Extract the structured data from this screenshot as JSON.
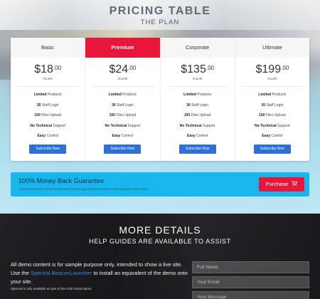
{
  "header": {
    "title": "PRICING TABLE",
    "subtitle": "THE PLAN"
  },
  "plans": [
    {
      "name": "Basic",
      "currency": "$",
      "amount": "18",
      "cents": ".00",
      "period": "/month",
      "features": [
        {
          "bold": "Limited",
          "text": " Products"
        },
        {
          "bold": "30",
          "text": " Staff Login"
        },
        {
          "bold": "150",
          "text": " Files Upload"
        },
        {
          "bold": "No Technical",
          "text": " Support"
        },
        {
          "bold": "Easy",
          "text": " Control"
        }
      ],
      "button": "Subscribe Now",
      "featured": false
    },
    {
      "name": "Premium",
      "currency": "$",
      "amount": "24",
      "cents": ".00",
      "period": "/month",
      "features": [
        {
          "bold": "Limited",
          "text": " Products"
        },
        {
          "bold": "30",
          "text": " Staff Login"
        },
        {
          "bold": "150",
          "text": " Files Upload"
        },
        {
          "bold": "No Technical",
          "text": " Support"
        },
        {
          "bold": "Easy",
          "text": " Control"
        }
      ],
      "button": "Subscribe Now",
      "featured": true
    },
    {
      "name": "Corporate",
      "currency": "$",
      "amount": "135",
      "cents": ".00",
      "period": "/month",
      "features": [
        {
          "bold": "Limited",
          "text": " Products"
        },
        {
          "bold": "30",
          "text": " Staff Login"
        },
        {
          "bold": "150",
          "text": " Files Upload"
        },
        {
          "bold": "No Technical",
          "text": " Support"
        },
        {
          "bold": "Easy",
          "text": " Control"
        }
      ],
      "button": "Subscribe Now",
      "featured": false
    },
    {
      "name": "Ultimate",
      "currency": "$",
      "amount": "199",
      "cents": ".00",
      "period": "/month",
      "features": [
        {
          "bold": "Limited",
          "text": " Products"
        },
        {
          "bold": "30",
          "text": " Staff Login"
        },
        {
          "bold": "150",
          "text": " Files Upload"
        },
        {
          "bold": "No Technical",
          "text": " Support"
        },
        {
          "bold": "Easy",
          "text": " Control"
        }
      ],
      "button": "Subscribe Now",
      "featured": false
    }
  ],
  "guarantee": {
    "title": "100% Money Back Guarantee",
    "text": "Lorem ipsum dolor sit amet maecenas ornare fuga deserunt tempora esse denique ratione dolor.",
    "button": "Purchase",
    "button_icon": "cart-icon"
  },
  "details": {
    "title": "MORE DETAILS",
    "subtitle": "HELP GUIDES ARE AVAILABLE TO ASSIST",
    "para_before": "All demo content is for sample purpose only, intended to show a live site. Use the ",
    "para_link": "Spectral BeaconLauncher",
    "para_after": " to install an equivalent of the demo onto your site.",
    "note": "Spectral is only available as part of the Club Subscription.",
    "form": {
      "name_placeholder": "Full Name",
      "email_placeholder": "Your Email",
      "message_placeholder": "Your Message"
    }
  },
  "colors": {
    "accent_red": "#e8173a",
    "button_blue": "#2e6fd8",
    "banner_cyan": "#17b6ec"
  }
}
